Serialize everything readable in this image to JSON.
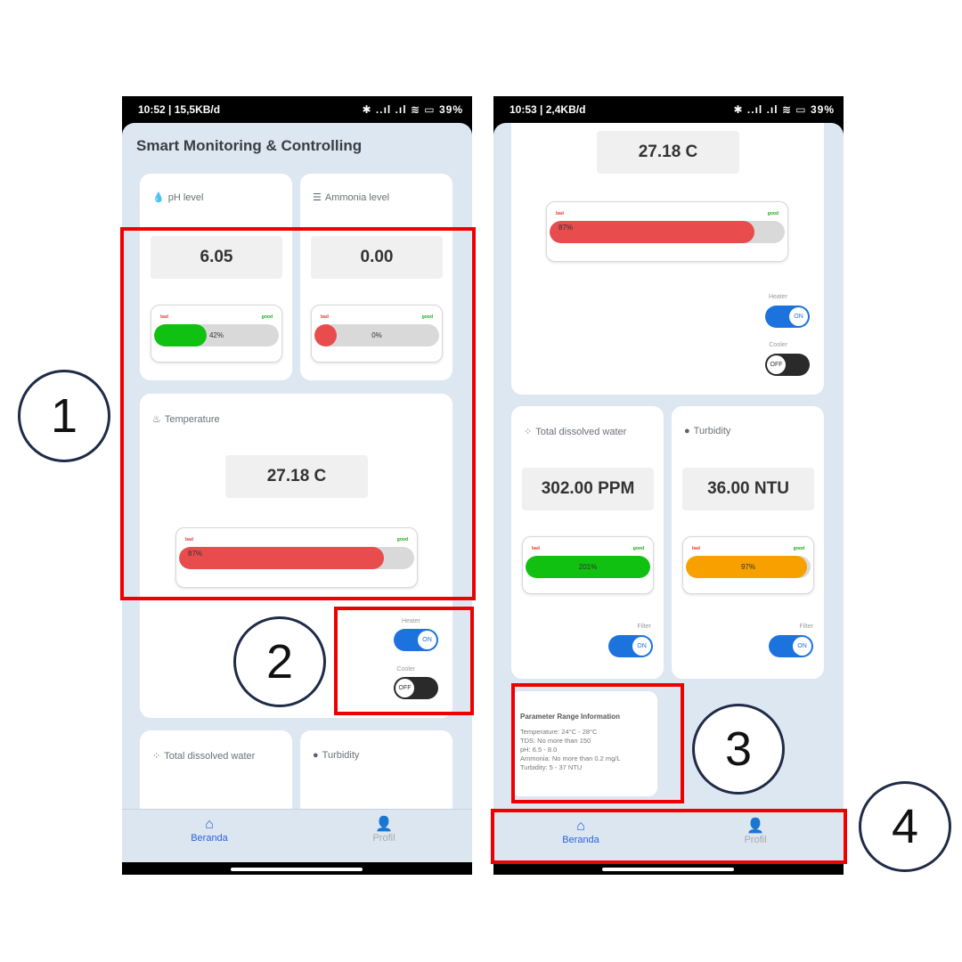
{
  "left_screen": {
    "status": {
      "time": "10:52 | 15,5KB/d",
      "icons": "✱ ..ıl .ıl ≋ ▭ 39%"
    },
    "title": "Smart Monitoring & Controlling",
    "ph": {
      "label": "pH level",
      "value": "6.05",
      "bad": "bad",
      "good": "good",
      "pct_text": "42%",
      "pct": 0.42,
      "color": "#11c111"
    },
    "ammonia": {
      "label": "Ammonia level",
      "value": "0.00",
      "bad": "bad",
      "good": "good",
      "pct_text": "0%",
      "pct": 0.0,
      "color": "#e84c4c"
    },
    "temperature": {
      "label": "Temperature",
      "value": "27.18 C",
      "bad": "bad",
      "good": "good",
      "pct_text": "87%",
      "pct": 0.87,
      "color": "#e84c4c"
    },
    "heater": {
      "label": "Heater",
      "state": "ON"
    },
    "cooler": {
      "label": "Cooler",
      "state": "OFF"
    },
    "tds": {
      "label": "Total dissolved water"
    },
    "turbidity": {
      "label": "Turbidity"
    },
    "nav": {
      "home": "Beranda",
      "profile": "Profil"
    }
  },
  "right_screen": {
    "status": {
      "time": "10:53 | 2,4KB/d",
      "icons": "✱ ..ıl .ıl ≋ ▭ 39%"
    },
    "temperature": {
      "value": "27.18 C",
      "bad": "bad",
      "good": "good",
      "pct_text": "87%",
      "pct": 0.87,
      "color": "#e84c4c"
    },
    "heater": {
      "label": "Heater",
      "state": "ON"
    },
    "cooler": {
      "label": "Cooler",
      "state": "OFF"
    },
    "tds": {
      "label": "Total dissolved water",
      "value": "302.00 PPM",
      "bad": "bad",
      "good": "good",
      "pct_text": "201%",
      "pct": 1.0,
      "color": "#11c111",
      "filter_label": "Filter",
      "filter_state": "ON"
    },
    "turbidity": {
      "label": "Turbidity",
      "value": "36.00 NTU",
      "bad": "bad",
      "good": "good",
      "pct_text": "97%",
      "pct": 0.97,
      "color": "#f7a000",
      "filter_label": "Filter",
      "filter_state": "ON"
    },
    "info": {
      "title": "Parameter Range Information",
      "lines": [
        "Temperature: 24°C - 28°C",
        "TDS: No more than 150",
        "pH: 6.5 - 8.0",
        "Ammonia: No more than 0.2 mg/L",
        "Turbidity: 5 - 37 NTU"
      ]
    },
    "nav": {
      "home": "Beranda",
      "profile": "Profil"
    }
  },
  "callouts": [
    "1",
    "2",
    "3",
    "4"
  ],
  "colors": {
    "highlight": "#ef0000",
    "accent": "#1c73de",
    "nav_active": "#2a63d8"
  }
}
